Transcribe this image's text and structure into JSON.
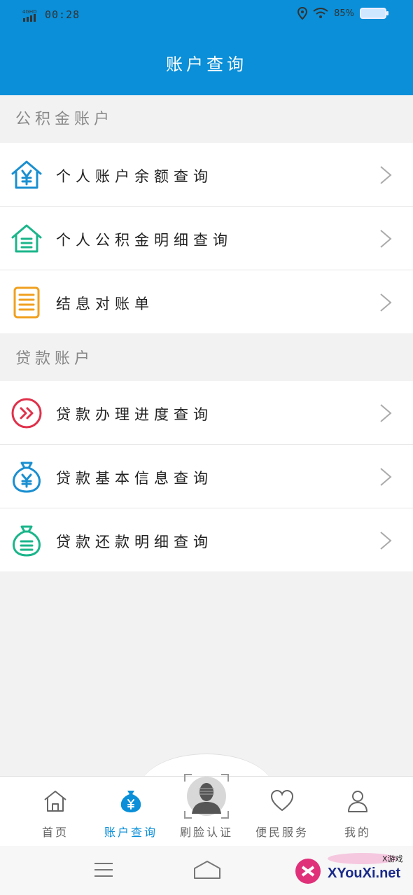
{
  "status_bar": {
    "network": "4G HD",
    "time": "00:28",
    "battery": "85%"
  },
  "header": {
    "title": "账户查询"
  },
  "sections": [
    {
      "title": "公积金账户",
      "items": [
        {
          "label": "个人账户余额查询",
          "icon": "house-yen-icon",
          "color": "#1a8fd0"
        },
        {
          "label": "个人公积金明细查询",
          "icon": "house-list-icon",
          "color": "#1bb58a"
        },
        {
          "label": "结息对账单",
          "icon": "document-icon",
          "color": "#f0a020"
        }
      ]
    },
    {
      "title": "贷款账户",
      "items": [
        {
          "label": "贷款办理进度查询",
          "icon": "progress-circle-icon",
          "color": "#e0304a"
        },
        {
          "label": "贷款基本信息查询",
          "icon": "money-bag-yen-icon",
          "color": "#1a8fd0"
        },
        {
          "label": "贷款还款明细查询",
          "icon": "money-bag-list-icon",
          "color": "#1bb58a"
        }
      ]
    }
  ],
  "tabbar": {
    "tabs": [
      {
        "label": "首页",
        "icon": "home-icon"
      },
      {
        "label": "账户查询",
        "icon": "money-bag-icon",
        "active": true
      },
      {
        "label": "刷脸认证",
        "icon": "face-scan-icon"
      },
      {
        "label": "便民服务",
        "icon": "heart-icon"
      },
      {
        "label": "我的",
        "icon": "user-icon"
      }
    ]
  },
  "watermark": {
    "text": "XYouXi.net",
    "small": "X游戏"
  },
  "colors": {
    "primary": "#0a8fd8",
    "background": "#f2f2f2"
  }
}
